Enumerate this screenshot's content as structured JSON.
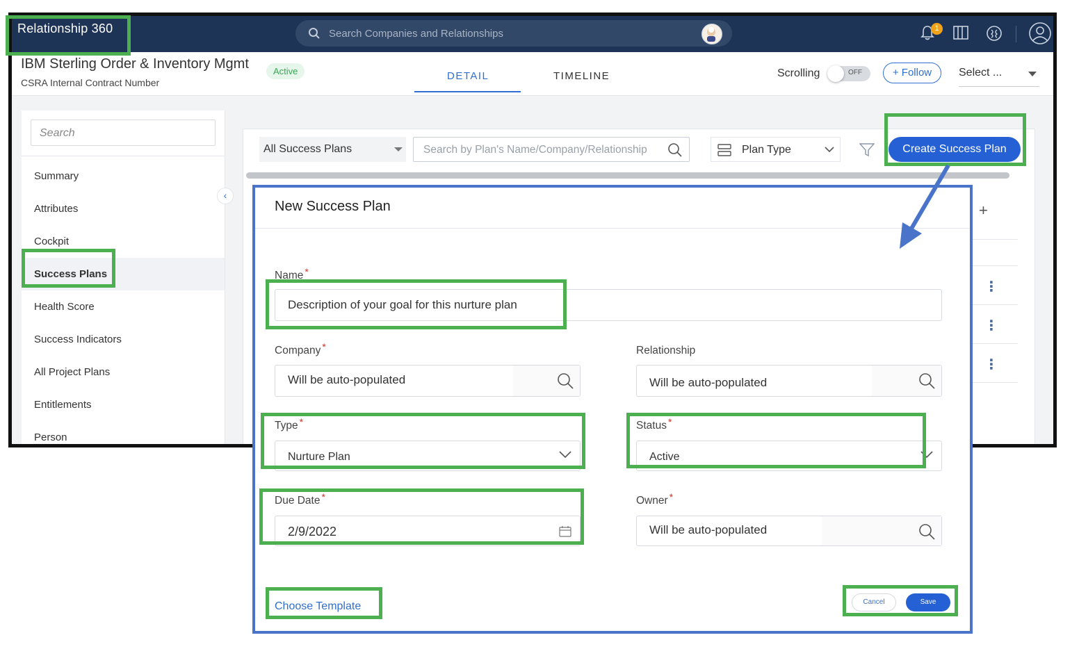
{
  "app": {
    "title": "Relationship 360",
    "search_placeholder": "Search Companies and Relationships",
    "notification_count": "1"
  },
  "header": {
    "company_name": "IBM Sterling Order & Inventory Mgmt",
    "subtitle": "CSRA Internal Contract Number",
    "status_badge": "Active",
    "tabs": [
      {
        "label": "DETAIL",
        "active": true
      },
      {
        "label": "TIMELINE",
        "active": false
      }
    ],
    "scrolling_label": "Scrolling",
    "scrolling_toggle": "OFF",
    "follow_label": "+ Follow",
    "select_label": "Select ..."
  },
  "sidebar": {
    "search_placeholder": "Search",
    "items": [
      {
        "label": "Summary",
        "active": false
      },
      {
        "label": "Attributes",
        "active": false
      },
      {
        "label": "Cockpit",
        "active": false
      },
      {
        "label": "Success Plans",
        "active": true
      },
      {
        "label": "Health Score",
        "active": false
      },
      {
        "label": "Success Indicators",
        "active": false
      },
      {
        "label": "All Project Plans",
        "active": false
      },
      {
        "label": "Entitlements",
        "active": false
      },
      {
        "label": "Person",
        "active": false
      }
    ]
  },
  "toolbar": {
    "plans_filter": "All Success Plans",
    "plan_search_placeholder": "Search by Plan's Name/Company/Relationship",
    "plan_type": "Plan Type",
    "create_button": "Create Success Plan"
  },
  "modal": {
    "title": "New Success Plan",
    "required_marker": "*",
    "fields": {
      "name": {
        "label": "Name",
        "value": "Description of your goal for this nurture plan"
      },
      "company": {
        "label": "Company",
        "value": "Will be auto-populated"
      },
      "relationship": {
        "label": "Relationship",
        "value": "Will be auto-populated"
      },
      "type": {
        "label": "Type",
        "value": "Nurture Plan"
      },
      "status": {
        "label": "Status",
        "value": "Active"
      },
      "due_date": {
        "label": "Due Date",
        "value": "2/9/2022"
      },
      "owner": {
        "label": "Owner",
        "value": "Will be auto-populated"
      }
    },
    "choose_template": "Choose Template",
    "cancel_label": "Cancel",
    "save_label": "Save"
  },
  "colors": {
    "topbar": "#1d3457",
    "primary": "#2561d4",
    "highlight": "#4caf50",
    "modal_border": "#4a74c9"
  }
}
